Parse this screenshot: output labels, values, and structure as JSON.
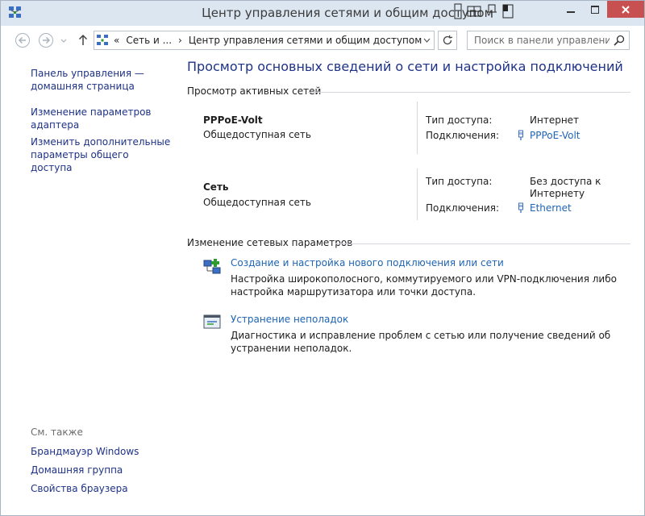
{
  "window": {
    "title": "Центр управления сетями и общим доступом"
  },
  "nav": {
    "breadcrumb_overflow": "«",
    "breadcrumb_1": "Сеть и ...",
    "breadcrumb_sep": "›",
    "breadcrumb_2": "Центр управления сетями и общим доступом",
    "search_placeholder": "Поиск в панели управления"
  },
  "sidebar": {
    "links": [
      "Панель управления — домашняя страница",
      "Изменение параметров адаптера",
      "Изменить дополнительные параметры общего доступа"
    ],
    "see_also_label": "См. также",
    "see_also": [
      "Брандмауэр Windows",
      "Домашняя группа",
      "Свойства браузера"
    ]
  },
  "main": {
    "heading": "Просмотр основных сведений о сети и настройка подключений",
    "active_networks_label": "Просмотр активных сетей",
    "networks": [
      {
        "name": "PPPoE-Volt",
        "type": "Общедоступная сеть",
        "access_key": "Тип доступа:",
        "access_value": "Интернет",
        "conn_key": "Подключения:",
        "conn_value": "PPPoE-Volt"
      },
      {
        "name": "Сеть",
        "type": "Общедоступная сеть",
        "access_key": "Тип доступа:",
        "access_value": "Без доступа к Интернету",
        "conn_key": "Подключения:",
        "conn_value": "Ethernet"
      }
    ],
    "change_settings_label": "Изменение сетевых параметров",
    "tasks": [
      {
        "icon": "new-connection-icon",
        "title": "Создание и настройка нового подключения или сети",
        "desc": "Настройка широкополосного, коммутируемого или VPN-подключения либо настройка маршрутизатора или точки доступа."
      },
      {
        "icon": "troubleshoot-icon",
        "title": "Устранение неполадок",
        "desc": "Диагностика и исправление проблем с сетью или получение сведений об устранении неполадок."
      }
    ]
  },
  "colors": {
    "link": "#1e3287",
    "accent_link": "#1e64b4",
    "titlebar": "#dce6f0",
    "close_button": "#c75050"
  }
}
